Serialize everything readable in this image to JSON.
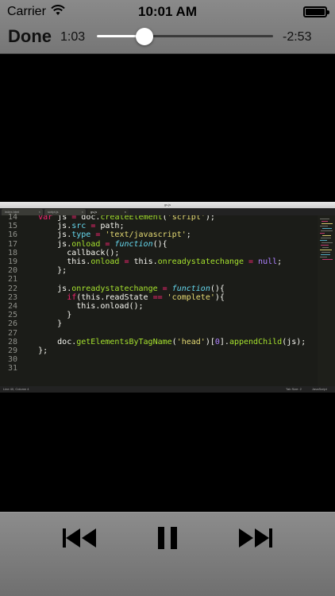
{
  "status": {
    "carrier": "Carrier",
    "time": "10:01 AM",
    "battery_level": 1.0
  },
  "player": {
    "done_label": "Done",
    "elapsed": "1:03",
    "remaining": "-2:53",
    "progress": 0.27
  },
  "editor": {
    "window_title": "gs.js",
    "tabs": [
      {
        "label": "index.html",
        "active": false
      },
      {
        "label": "script.js",
        "active": false
      },
      {
        "label": "gs.js",
        "active": true
      }
    ],
    "lines": [
      {
        "n": "14",
        "tokens": [
          [
            "",
            "    "
          ],
          [
            "kw",
            "var"
          ],
          [
            "",
            " js "
          ],
          [
            "kw",
            "="
          ],
          [
            "",
            " doc."
          ],
          [
            "fn",
            "createElement"
          ],
          [
            "",
            "("
          ],
          [
            "st",
            "'script'"
          ],
          [
            "",
            ");"
          ]
        ]
      },
      {
        "n": "15",
        "tokens": [
          [
            "",
            "        js."
          ],
          [
            "pr",
            "src"
          ],
          [
            "kw",
            " ="
          ],
          [
            "",
            " path;"
          ]
        ]
      },
      {
        "n": "16",
        "tokens": [
          [
            "",
            "        js."
          ],
          [
            "pr",
            "type"
          ],
          [
            "kw",
            " ="
          ],
          [
            "st",
            " 'text/javascript'"
          ],
          [
            "",
            ";"
          ]
        ]
      },
      {
        "n": "17",
        "tokens": [
          [
            "",
            "        js."
          ],
          [
            "fn",
            "onload"
          ],
          [
            "kw",
            " ="
          ],
          [
            "sp",
            " function"
          ],
          [
            "",
            "(){"
          ]
        ]
      },
      {
        "n": "18",
        "tokens": [
          [
            "",
            "          callback();"
          ]
        ]
      },
      {
        "n": "19",
        "tokens": [
          [
            "",
            "          this."
          ],
          [
            "fn",
            "onload"
          ],
          [
            "kw",
            " ="
          ],
          [
            "",
            " this."
          ],
          [
            "fn",
            "onreadystatechange"
          ],
          [
            "kw",
            " ="
          ],
          [
            "nm",
            " null"
          ],
          [
            "",
            ";"
          ]
        ]
      },
      {
        "n": "20",
        "tokens": [
          [
            "",
            "        };"
          ]
        ]
      },
      {
        "n": "21",
        "tokens": [
          [
            "",
            ""
          ]
        ]
      },
      {
        "n": "22",
        "tokens": [
          [
            "",
            "        js."
          ],
          [
            "fn",
            "onreadystatechange"
          ],
          [
            "kw",
            " ="
          ],
          [
            "sp",
            " function"
          ],
          [
            "",
            "(){"
          ]
        ]
      },
      {
        "n": "23",
        "tokens": [
          [
            "",
            "          "
          ],
          [
            "kw",
            "if"
          ],
          [
            "",
            "(this.readState "
          ],
          [
            "kw",
            "=="
          ],
          [
            "st",
            " 'complete'"
          ],
          [
            "",
            "){"
          ]
        ]
      },
      {
        "n": "24",
        "tokens": [
          [
            "",
            "            this.onload();"
          ]
        ]
      },
      {
        "n": "25",
        "tokens": [
          [
            "",
            "          }"
          ]
        ]
      },
      {
        "n": "26",
        "tokens": [
          [
            "",
            "        }"
          ]
        ]
      },
      {
        "n": "27",
        "tokens": [
          [
            "",
            ""
          ]
        ]
      },
      {
        "n": "28",
        "tokens": [
          [
            "",
            "        doc."
          ],
          [
            "fn",
            "getElementsByTagName"
          ],
          [
            "",
            "("
          ],
          [
            "st",
            "'head'"
          ],
          [
            "",
            ")["
          ],
          [
            "nm",
            "0"
          ],
          [
            "",
            "]."
          ],
          [
            "fn",
            "appendChild"
          ],
          [
            "",
            "(js);"
          ]
        ]
      },
      {
        "n": "29",
        "tokens": [
          [
            "",
            "    };"
          ]
        ]
      },
      {
        "n": "30",
        "tokens": [
          [
            "",
            ""
          ]
        ]
      },
      {
        "n": "31",
        "tokens": [
          [
            "",
            ""
          ]
        ]
      }
    ],
    "statusbar": {
      "position": "Line 40, Column 4",
      "tab_size": "Tab Size: 2",
      "syntax": "JavaScript"
    }
  },
  "controls": {
    "previous_icon": "skip-back-icon",
    "pause_icon": "pause-icon",
    "next_icon": "skip-forward-icon"
  },
  "colors": {
    "bar_gray": "#808080",
    "editor_bg": "#1b1c18",
    "keyword": "#f92672",
    "string": "#e6db74",
    "function": "#a6e22e",
    "storage": "#66d9ef"
  }
}
